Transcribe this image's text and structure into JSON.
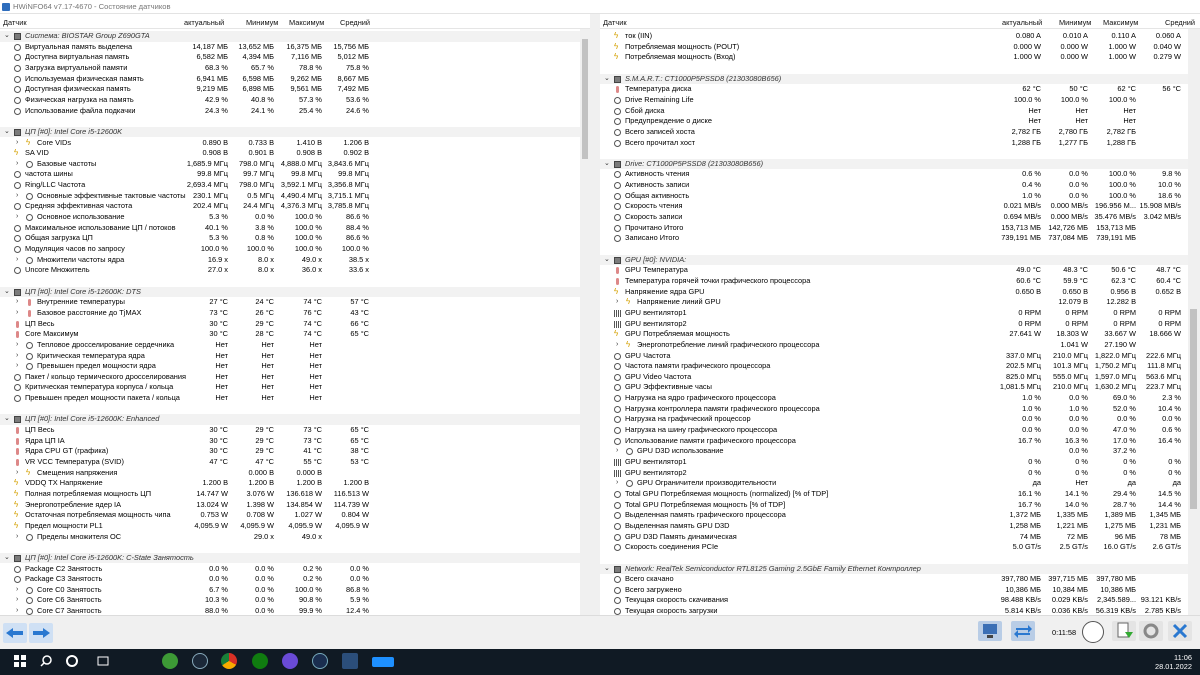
{
  "window": {
    "title": "HWiNFO64 v7.17-4670 - Состояние датчиков"
  },
  "headers": {
    "sensor": "Датчик",
    "current": "актуальный",
    "min": "Минимум",
    "max": "Максимум",
    "avg": "Средний"
  },
  "left_rows": [
    {
      "t": "g",
      "label": "Система: BIOSTAR Group Z690GTA"
    },
    {
      "t": "r",
      "ic": "clk",
      "label": "Виртуальная память выделена",
      "v": [
        "14,187 МБ",
        "13,652 МБ",
        "16,375 МБ",
        "15,756 МБ"
      ]
    },
    {
      "t": "r",
      "ic": "clk",
      "label": "Доступна виртуальная память",
      "v": [
        "6,582 МБ",
        "4,394 МБ",
        "7,116 МБ",
        "5,012 МБ"
      ]
    },
    {
      "t": "r",
      "ic": "clk",
      "label": "Загрузка виртуальной памяти",
      "v": [
        "68.3 %",
        "65.7 %",
        "78.8 %",
        "75.8 %"
      ]
    },
    {
      "t": "r",
      "ic": "clk",
      "label": "Используемая физическая память",
      "v": [
        "6,941 МБ",
        "6,598 МБ",
        "9,262 МБ",
        "8,667 МБ"
      ]
    },
    {
      "t": "r",
      "ic": "clk",
      "label": "Доступная физическая память",
      "v": [
        "9,219 МБ",
        "6,898 МБ",
        "9,561 МБ",
        "7,492 МБ"
      ]
    },
    {
      "t": "r",
      "ic": "clk",
      "label": "Физическая нагрузка на память",
      "v": [
        "42.9 %",
        "40.8 %",
        "57.3 %",
        "53.6 %"
      ]
    },
    {
      "t": "r",
      "ic": "clk",
      "label": "Использование файла подкачки",
      "v": [
        "24.3 %",
        "24.1 %",
        "25.4 %",
        "24.6 %"
      ]
    },
    {
      "t": "b"
    },
    {
      "t": "g",
      "label": "ЦП [#0]: Intel Core i5-12600K"
    },
    {
      "t": "r",
      "ex": 1,
      "ic": "bolt",
      "label": "Core VIDs",
      "v": [
        "0.890 В",
        "0.733 В",
        "1.410 В",
        "1.206 В"
      ]
    },
    {
      "t": "r",
      "ic": "bolt",
      "label": "SA VID",
      "v": [
        "0.908 В",
        "0.901 В",
        "0.908 В",
        "0.902 В"
      ]
    },
    {
      "t": "r",
      "ex": 1,
      "ic": "clk",
      "label": "Базовые частоты",
      "v": [
        "1,685.9 МГц",
        "798.0 МГц",
        "4,888.0 МГц",
        "3,843.6 МГц"
      ]
    },
    {
      "t": "r",
      "ic": "clk",
      "label": "частота шины",
      "v": [
        "99.8 МГц",
        "99.7 МГц",
        "99.8 МГц",
        "99.8 МГц"
      ]
    },
    {
      "t": "r",
      "ic": "clk",
      "label": "Ring/LLC Частота",
      "v": [
        "2,693.4 МГц",
        "798.0 МГц",
        "3,592.1 МГц",
        "3,356.8 МГц"
      ]
    },
    {
      "t": "r",
      "ex": 1,
      "ic": "clk",
      "label": "Основные эффективные тактовые частоты",
      "v": [
        "230.1 МГц",
        "0.5 МГц",
        "4,490.4 МГц",
        "3,715.1 МГц"
      ]
    },
    {
      "t": "r",
      "ic": "clk",
      "label": "Средняя эффективная частота",
      "v": [
        "202.4 МГц",
        "24.4 МГц",
        "4,376.3 МГц",
        "3,785.8 МГц"
      ]
    },
    {
      "t": "r",
      "ex": 1,
      "ic": "clk",
      "label": "Основное использование",
      "v": [
        "5.3 %",
        "0.0 %",
        "100.0 %",
        "86.6 %"
      ]
    },
    {
      "t": "r",
      "ic": "clk",
      "label": "Максимальное использование ЦП / потоков",
      "v": [
        "40.1 %",
        "3.8 %",
        "100.0 %",
        "88.4 %"
      ]
    },
    {
      "t": "r",
      "ic": "clk",
      "label": "Общая загрузка ЦП",
      "v": [
        "5.3 %",
        "0.8 %",
        "100.0 %",
        "86.6 %"
      ]
    },
    {
      "t": "r",
      "ic": "clk",
      "label": "Модуляция часов по запросу",
      "v": [
        "100.0 %",
        "100.0 %",
        "100.0 %",
        "100.0 %"
      ]
    },
    {
      "t": "r",
      "ex": 1,
      "ic": "clk",
      "label": "Множители частоты ядра",
      "v": [
        "16.9 x",
        "8.0 x",
        "49.0 x",
        "38.5 x"
      ]
    },
    {
      "t": "r",
      "ic": "clk",
      "label": "Uncore Множитель",
      "v": [
        "27.0 x",
        "8.0 x",
        "36.0 x",
        "33.6 x"
      ]
    },
    {
      "t": "b"
    },
    {
      "t": "g",
      "label": "ЦП [#0]: Intel Core i5-12600K: DTS"
    },
    {
      "t": "r",
      "ex": 1,
      "ic": "therm",
      "label": "Внутренние температуры",
      "v": [
        "27 °C",
        "24 °C",
        "74 °C",
        "57 °C"
      ]
    },
    {
      "t": "r",
      "ex": 1,
      "ic": "therm",
      "label": "Базовое расстояние до TjMAX",
      "v": [
        "73 °C",
        "26 °C",
        "76 °C",
        "43 °C"
      ]
    },
    {
      "t": "r",
      "ic": "therm",
      "label": "ЦП Весь",
      "v": [
        "30 °C",
        "29 °C",
        "74 °C",
        "66 °C"
      ]
    },
    {
      "t": "r",
      "ic": "therm",
      "label": "Core Максимум",
      "v": [
        "30 °C",
        "28 °C",
        "74 °C",
        "65 °C"
      ]
    },
    {
      "t": "r",
      "ex": 1,
      "ic": "clk",
      "label": "Тепловое дросселирование сердечника",
      "v": [
        "Нет",
        "Нет",
        "Нет",
        ""
      ]
    },
    {
      "t": "r",
      "ex": 1,
      "ic": "clk",
      "label": "Критическая температура ядра",
      "v": [
        "Нет",
        "Нет",
        "Нет",
        ""
      ]
    },
    {
      "t": "r",
      "ex": 1,
      "ic": "clk",
      "label": "Превышен предел мощности ядра",
      "v": [
        "Нет",
        "Нет",
        "Нет",
        ""
      ]
    },
    {
      "t": "r",
      "ic": "clk",
      "label": "Пакет / кольцо термического дросселирования",
      "v": [
        "Нет",
        "Нет",
        "Нет",
        ""
      ]
    },
    {
      "t": "r",
      "ic": "clk",
      "label": "Критическая температура корпуса / кольца",
      "v": [
        "Нет",
        "Нет",
        "Нет",
        ""
      ]
    },
    {
      "t": "r",
      "ic": "clk",
      "label": "Превышен предел мощности пакета / кольца",
      "v": [
        "Нет",
        "Нет",
        "Нет",
        ""
      ]
    },
    {
      "t": "b"
    },
    {
      "t": "g",
      "label": "ЦП [#0]: Intel Core i5-12600K: Enhanced"
    },
    {
      "t": "r",
      "ic": "therm",
      "label": "ЦП Весь",
      "v": [
        "30 °C",
        "29 °C",
        "73 °C",
        "65 °C"
      ]
    },
    {
      "t": "r",
      "ic": "therm",
      "label": "Ядра ЦП IA",
      "v": [
        "30 °C",
        "29 °C",
        "73 °C",
        "65 °C"
      ]
    },
    {
      "t": "r",
      "ic": "therm",
      "label": "Ядра CPU GT (графика)",
      "v": [
        "30 °C",
        "29 °C",
        "41 °C",
        "38 °C"
      ]
    },
    {
      "t": "r",
      "ic": "therm",
      "label": "VR VCC Температура (SVID)",
      "v": [
        "47 °C",
        "47 °C",
        "55 °C",
        "53 °C"
      ]
    },
    {
      "t": "r",
      "ex": 1,
      "ic": "bolt",
      "label": "Смещения напряжения",
      "v": [
        "",
        "0.000 В",
        "0.000 В",
        ""
      ]
    },
    {
      "t": "r",
      "ic": "bolt",
      "label": "VDDQ TX Напряжение",
      "v": [
        "1.200 В",
        "1.200 В",
        "1.200 В",
        "1.200 В"
      ]
    },
    {
      "t": "r",
      "ic": "bolt",
      "label": "Полная потребляемая мощность ЦП",
      "v": [
        "14.747 W",
        "3.076 W",
        "136.618 W",
        "116.513 W"
      ]
    },
    {
      "t": "r",
      "ic": "bolt",
      "label": "Энергопотребление ядер IA",
      "v": [
        "13.024 W",
        "1.398 W",
        "134.854 W",
        "114.739 W"
      ]
    },
    {
      "t": "r",
      "ic": "bolt",
      "label": "Остаточная потребляемая мощность чипа",
      "v": [
        "0.753 W",
        "0.708 W",
        "1.027 W",
        "0.804 W"
      ]
    },
    {
      "t": "r",
      "ic": "bolt",
      "label": "Предел мощности PL1",
      "v": [
        "4,095.9 W",
        "4,095.9 W",
        "4,095.9 W",
        "4,095.9 W"
      ]
    },
    {
      "t": "r",
      "ex": 1,
      "ic": "clk",
      "label": "Пределы множителя ОС",
      "v": [
        "",
        "29.0 x",
        "49.0 x",
        ""
      ]
    },
    {
      "t": "b"
    },
    {
      "t": "g",
      "label": "ЦП [#0]: Intel Core i5-12600K: C-State Занятость"
    },
    {
      "t": "r",
      "ic": "clk",
      "label": "Package C2 Занятость",
      "v": [
        "0.0 %",
        "0.0 %",
        "0.2 %",
        "0.0 %"
      ]
    },
    {
      "t": "r",
      "ic": "clk",
      "label": "Package C3 Занятость",
      "v": [
        "0.0 %",
        "0.0 %",
        "0.2 %",
        "0.0 %"
      ]
    },
    {
      "t": "r",
      "ex": 1,
      "ic": "clk",
      "label": "Core C0 Занятость",
      "v": [
        "6.7 %",
        "0.0 %",
        "100.0 %",
        "86.8 %"
      ]
    },
    {
      "t": "r",
      "ex": 1,
      "ic": "clk",
      "label": "Core C6 Занятость",
      "v": [
        "10.3 %",
        "0.0 %",
        "90.8 %",
        "5.9 %"
      ]
    },
    {
      "t": "r",
      "ex": 1,
      "ic": "clk",
      "label": "Core C7 Занятость",
      "v": [
        "88.0 %",
        "0.0 %",
        "99.9 %",
        "12.4 %"
      ]
    }
  ],
  "right_rows": [
    {
      "t": "r",
      "ic": "bolt",
      "label": "ток (IIN)",
      "v": [
        "0.080 A",
        "0.010 A",
        "0.110 A",
        "0.060 A"
      ]
    },
    {
      "t": "r",
      "ic": "bolt",
      "label": "Потребляемая мощность (POUT)",
      "v": [
        "0.000 W",
        "0.000 W",
        "1.000 W",
        "0.040 W"
      ]
    },
    {
      "t": "r",
      "ic": "bolt",
      "label": "Потребляемая мощность (Вход)",
      "v": [
        "1.000 W",
        "0.000 W",
        "1.000 W",
        "0.279 W"
      ]
    },
    {
      "t": "b"
    },
    {
      "t": "g",
      "label": "S.M.A.R.T.: CT1000P5PSSD8 (21303080B656)"
    },
    {
      "t": "r",
      "ic": "therm",
      "label": "Температура диска",
      "v": [
        "62 °C",
        "50 °C",
        "62 °C",
        "56 °C"
      ]
    },
    {
      "t": "r",
      "ic": "clk",
      "label": "Drive Remaining Life",
      "v": [
        "100.0 %",
        "100.0 %",
        "100.0 %",
        ""
      ]
    },
    {
      "t": "r",
      "ic": "clk",
      "label": "Сбой диска",
      "v": [
        "Нет",
        "Нет",
        "Нет",
        ""
      ]
    },
    {
      "t": "r",
      "ic": "clk",
      "label": "Предупреждение о диске",
      "v": [
        "Нет",
        "Нет",
        "Нет",
        ""
      ]
    },
    {
      "t": "r",
      "ic": "clk",
      "label": "Всего записей хоста",
      "v": [
        "2,782 ГБ",
        "2,780 ГБ",
        "2,782 ГБ",
        ""
      ]
    },
    {
      "t": "r",
      "ic": "clk",
      "label": "Всего прочитал хост",
      "v": [
        "1,288 ГБ",
        "1,277 ГБ",
        "1,288 ГБ",
        ""
      ]
    },
    {
      "t": "b"
    },
    {
      "t": "g",
      "label": "Drive: CT1000P5PSSD8 (21303080B656)"
    },
    {
      "t": "r",
      "ic": "clk",
      "label": "Активность чтения",
      "v": [
        "0.6 %",
        "0.0 %",
        "100.0 %",
        "9.8 %"
      ]
    },
    {
      "t": "r",
      "ic": "clk",
      "label": "Активность записи",
      "v": [
        "0.4 %",
        "0.0 %",
        "100.0 %",
        "10.0 %"
      ]
    },
    {
      "t": "r",
      "ic": "clk",
      "label": "Общая активность",
      "v": [
        "1.0 %",
        "0.0 %",
        "100.0 %",
        "18.6 %"
      ]
    },
    {
      "t": "r",
      "ic": "clk",
      "label": "Скорость чтения",
      "v": [
        "0.021 MB/s",
        "0.000 MB/s",
        "196.956 M...",
        "15.908 MB/s"
      ]
    },
    {
      "t": "r",
      "ic": "clk",
      "label": "Скорость записи",
      "v": [
        "0.694 MB/s",
        "0.000 MB/s",
        "35.476 MB/s",
        "3.042 MB/s"
      ]
    },
    {
      "t": "r",
      "ic": "clk",
      "label": "Прочитано Итого",
      "v": [
        "153,713 МБ",
        "142,726 МБ",
        "153,713 МБ",
        ""
      ]
    },
    {
      "t": "r",
      "ic": "clk",
      "label": "Записано Итого",
      "v": [
        "739,191 МБ",
        "737,084 МБ",
        "739,191 МБ",
        ""
      ]
    },
    {
      "t": "b"
    },
    {
      "t": "g",
      "label": "GPU [#0]: NVIDIA:"
    },
    {
      "t": "r",
      "ic": "therm",
      "label": "GPU Температура",
      "v": [
        "49.0 °C",
        "48.3 °C",
        "50.6 °C",
        "48.7 °C"
      ]
    },
    {
      "t": "r",
      "ic": "therm",
      "label": "Температура горячей точки графического процессора",
      "v": [
        "60.6 °C",
        "59.9 °C",
        "62.3 °C",
        "60.4 °C"
      ]
    },
    {
      "t": "r",
      "ic": "bolt",
      "label": "Напряжение ядра GPU",
      "v": [
        "0.650 В",
        "0.650 В",
        "0.956 В",
        "0.652 В"
      ]
    },
    {
      "t": "r",
      "ex": 1,
      "ic": "bolt",
      "label": "Напряжение линий GPU",
      "v": [
        "",
        "12.079 В",
        "12.282 В",
        ""
      ]
    },
    {
      "t": "r",
      "ic": "fan",
      "label": "GPU вентилятор1",
      "v": [
        "0 RPM",
        "0 RPM",
        "0 RPM",
        "0 RPM"
      ]
    },
    {
      "t": "r",
      "ic": "fan",
      "label": "GPU вентилятор2",
      "v": [
        "0 RPM",
        "0 RPM",
        "0 RPM",
        "0 RPM"
      ]
    },
    {
      "t": "r",
      "ic": "bolt",
      "label": "GPU Потребляемая мощность",
      "v": [
        "27.641 W",
        "18.303 W",
        "33.667 W",
        "18.666 W"
      ]
    },
    {
      "t": "r",
      "ex": 1,
      "ic": "bolt",
      "label": "Энергопотребление линий графического процессора",
      "v": [
        "",
        "1.041 W",
        "27.190 W",
        ""
      ]
    },
    {
      "t": "r",
      "ic": "clk",
      "label": "GPU Частота",
      "v": [
        "337.0 МГц",
        "210.0 МГц",
        "1,822.0 МГц",
        "222.6 МГц"
      ]
    },
    {
      "t": "r",
      "ic": "clk",
      "label": "Частота памяти графического процессора",
      "v": [
        "202.5 МГц",
        "101.3 МГц",
        "1,750.2 МГц",
        "111.8 МГц"
      ]
    },
    {
      "t": "r",
      "ic": "clk",
      "label": "GPU Video Частота",
      "v": [
        "825.0 МГц",
        "555.0 МГц",
        "1,597.0 МГц",
        "563.6 МГц"
      ]
    },
    {
      "t": "r",
      "ic": "clk",
      "label": "GPU Эффективные часы",
      "v": [
        "1,081.5 МГц",
        "210.0 МГц",
        "1,630.2 МГц",
        "223.7 МГц"
      ]
    },
    {
      "t": "r",
      "ic": "clk",
      "label": "Нагрузка на ядро графического процессора",
      "v": [
        "1.0 %",
        "0.0 %",
        "69.0 %",
        "2.3 %"
      ]
    },
    {
      "t": "r",
      "ic": "clk",
      "label": "Нагрузка контроллера памяти графического процессора",
      "v": [
        "1.0 %",
        "1.0 %",
        "52.0 %",
        "10.4 %"
      ]
    },
    {
      "t": "r",
      "ic": "clk",
      "label": "Нагрузка на графический процессор",
      "v": [
        "0.0 %",
        "0.0 %",
        "0.0 %",
        "0.0 %"
      ]
    },
    {
      "t": "r",
      "ic": "clk",
      "label": "Нагрузка на шину графического процессора",
      "v": [
        "0.0 %",
        "0.0 %",
        "47.0 %",
        "0.6 %"
      ]
    },
    {
      "t": "r",
      "ic": "clk",
      "label": "Использование памяти графического процессора",
      "v": [
        "16.7 %",
        "16.3 %",
        "17.0 %",
        "16.4 %"
      ]
    },
    {
      "t": "r",
      "ex": 1,
      "ic": "clk",
      "label": "GPU D3D использование",
      "v": [
        "",
        "0.0 %",
        "37.2 %",
        ""
      ]
    },
    {
      "t": "r",
      "ic": "fan",
      "label": "GPU вентилятор1",
      "v": [
        "0 %",
        "0 %",
        "0 %",
        "0 %"
      ]
    },
    {
      "t": "r",
      "ic": "fan",
      "label": "GPU вентилятор2",
      "v": [
        "0 %",
        "0 %",
        "0 %",
        "0 %"
      ]
    },
    {
      "t": "r",
      "ex": 1,
      "ic": "clk",
      "label": "GPU Ограничители производительности",
      "v": [
        "да",
        "Нет",
        "да",
        "да"
      ]
    },
    {
      "t": "r",
      "ic": "clk",
      "label": "Total GPU Потребляемая мощность (normalized) [% of TDP]",
      "v": [
        "16.1 %",
        "14.1 %",
        "29.4 %",
        "14.5 %"
      ]
    },
    {
      "t": "r",
      "ic": "clk",
      "label": "Total GPU Потребляемая мощность [% of TDP]",
      "v": [
        "16.7 %",
        "14.0 %",
        "28.7 %",
        "14.4 %"
      ]
    },
    {
      "t": "r",
      "ic": "clk",
      "label": "Выделенная память графического процессора",
      "v": [
        "1,372 МБ",
        "1,335 МБ",
        "1,389 МБ",
        "1,345 МБ"
      ]
    },
    {
      "t": "r",
      "ic": "clk",
      "label": "Выделенная память GPU D3D",
      "v": [
        "1,258 МБ",
        "1,221 МБ",
        "1,275 МБ",
        "1,231 МБ"
      ]
    },
    {
      "t": "r",
      "ic": "clk",
      "label": "GPU D3D Память динамическая",
      "v": [
        "74 МБ",
        "72 МБ",
        "96 МБ",
        "78 МБ"
      ]
    },
    {
      "t": "r",
      "ic": "clk",
      "label": "Скорость соединения PCIe",
      "v": [
        "5.0 GT/s",
        "2.5 GT/s",
        "16.0 GT/s",
        "2.6 GT/s"
      ]
    },
    {
      "t": "b"
    },
    {
      "t": "g",
      "label": "Network: RealTek Semiconductor RTL8125 Gaming 2.5GbE Family Ethernet Контроллер"
    },
    {
      "t": "r",
      "ic": "clk",
      "label": "Всего скачано",
      "v": [
        "397,780 МБ",
        "397,715 МБ",
        "397,780 МБ",
        ""
      ]
    },
    {
      "t": "r",
      "ic": "clk",
      "label": "Всего загружено",
      "v": [
        "10,386 МБ",
        "10,384 МБ",
        "10,386 МБ",
        ""
      ]
    },
    {
      "t": "r",
      "ic": "clk",
      "label": "Текущая скорость скачивания",
      "v": [
        "98.488 KB/s",
        "0.029 KB/s",
        "2,345.589...",
        "93.121 KB/s"
      ]
    },
    {
      "t": "r",
      "ic": "clk",
      "label": "Текущая скорость загрузки",
      "v": [
        "5.814 KB/s",
        "0.036 KB/s",
        "56.319 KB/s",
        "2.785 KB/s"
      ]
    }
  ],
  "toolbar": {
    "elapsed": "0:11:58"
  },
  "taskbar": {
    "time": "11:06",
    "date": "28.01.2022"
  }
}
